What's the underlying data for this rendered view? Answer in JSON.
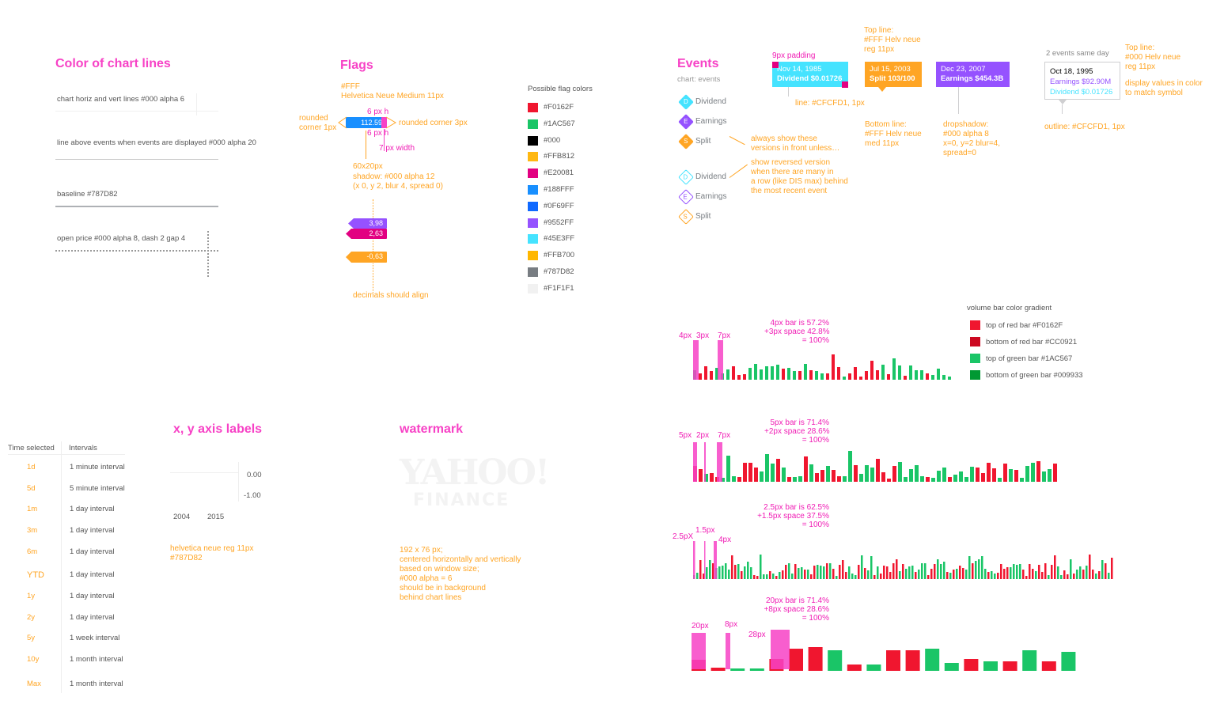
{
  "chart_lines": {
    "title": "Color of chart lines",
    "items": [
      "chart horiz and vert lines #000 alpha 6",
      "line above events when events are displayed #000 alpha 20",
      "baseline #787D82",
      "open price #000 alpha 8, dash 2 gap 4"
    ]
  },
  "flags": {
    "title": "Flags",
    "spec_1": "#FFF",
    "spec_2": "Helvetica Neue Medium 11px",
    "h_top": "6 px h",
    "h_bottom": "6 px h",
    "rounded_1px": "rounded\ncorner 1px",
    "rounded_3px": "rounded corner 3px",
    "width_note": "7 px width",
    "size_1": "60x20px",
    "size_2": "shadow: #000 alpha 12",
    "size_3": "(x 0, y 2, blur 4, spread 0)",
    "flag_main": "112.59",
    "flag_a": "3,98",
    "flag_b": "2,63",
    "flag_c": "-0,63",
    "decimals": "decimals should align",
    "palette_title": "Possible flag colors",
    "palette": [
      {
        "hex": "#F0162F",
        "label": "#F0162F"
      },
      {
        "hex": "#1AC567",
        "label": "#1AC567"
      },
      {
        "hex": "#000000",
        "label": "#000"
      },
      {
        "hex": "#FFB812",
        "label": "#FFB812"
      },
      {
        "hex": "#E20081",
        "label": "#E20081"
      },
      {
        "hex": "#188FFF",
        "label": "#188FFF"
      },
      {
        "hex": "#0F69FF",
        "label": "#0F69FF"
      },
      {
        "hex": "#9552FF",
        "label": "#9552FF"
      },
      {
        "hex": "#45E3FF",
        "label": "#45E3FF"
      },
      {
        "hex": "#FFB700",
        "label": "#FFB700"
      },
      {
        "hex": "#787D82",
        "label": "#787D82"
      },
      {
        "hex": "#F1F1F1",
        "label": "#F1F1F1"
      }
    ]
  },
  "events": {
    "title": "Events",
    "subtitle": "chart: events",
    "icons": [
      {
        "letter": "D",
        "label": "Dividend",
        "color": "#45E3FF"
      },
      {
        "letter": "E",
        "label": "Earnings",
        "color": "#9552FF"
      },
      {
        "letter": "S",
        "label": "Split",
        "color": "#FFA524"
      }
    ],
    "note_front": "always show these\nversions in front unless…",
    "note_reversed": "show reversed version\nwhen there are many in\na row (like DIS max) behind\nthe most recent event",
    "padding_note": "9px padding",
    "box_div_1": "Nov 14, 1985",
    "box_div_2": "Dividend $0.01726",
    "line_note": "line: #CFCFD1, 1px",
    "top_line_note": "Top line:\n#FFF Helv neue\nreg 11px",
    "box_split_1": "Jul 15, 2003",
    "box_split_2": "Split 103/100",
    "bottom_line_note": "Bottom line:\n#FFF Helv neue\nmed 11px",
    "box_earn_1": "Dec 23, 2007",
    "box_earn_2": "Earnings $454.3B",
    "dropshadow_note": "dropshadow:\n#000 alpha 8\nx=0, y=2 blur=4,\nspread=0",
    "same_day_title": "2 events same day",
    "same_day_date": "Oct 18, 1995",
    "same_day_earn": "Earnings $92.90M",
    "same_day_div": "Dividend $0.01726",
    "same_day_top": "Top line:\n#000 Helv neue\nreg 11px",
    "same_day_display": "display values in color\nto match symbol",
    "outline_note": "outline: #CFCFD1, 1px"
  },
  "volume": {
    "gradient_title": "volume bar color gradient",
    "gradient": [
      {
        "hex": "#F0162F",
        "label": "top of red bar #F0162F"
      },
      {
        "hex": "#CC0921",
        "label": "bottom of red bar #CC0921"
      },
      {
        "hex": "#1AC567",
        "label": "top of green bar #1AC567"
      },
      {
        "hex": "#009933",
        "label": "bottom of green bar #009933"
      }
    ],
    "groups": [
      {
        "note": "4px bar is 57.2%\n+3px space 42.8%\n= 100%",
        "labels": [
          "4px",
          "3px",
          "7px"
        ]
      },
      {
        "note": "5px bar is 71.4%\n+2px space 28.6%\n= 100%",
        "labels": [
          "5px",
          "2px",
          "7px"
        ]
      },
      {
        "note": "2.5px bar is 62.5%\n+1.5px space 37.5%\n= 100%",
        "labels": [
          "2.5pX",
          "1.5px",
          "4px"
        ]
      },
      {
        "note": "20px bar is 71.4%\n+8px space 28.6%\n= 100%",
        "labels": [
          "20px",
          "8px",
          "28px"
        ]
      }
    ]
  },
  "intervals": {
    "col_time": "Time selected",
    "col_interval": "Intervals",
    "rows": [
      {
        "time": "1d",
        "interval": "1 minute interval"
      },
      {
        "time": "5d",
        "interval": "5 minute interval"
      },
      {
        "time": "1m",
        "interval": "1 day interval"
      },
      {
        "time": "3m",
        "interval": "1 day interval"
      },
      {
        "time": "6m",
        "interval": "1 day interval"
      },
      {
        "time": "YTD",
        "interval": "1 day interval"
      },
      {
        "time": "1y",
        "interval": "1 day interval"
      },
      {
        "time": "2y",
        "interval": "1 day interval"
      },
      {
        "time": "5y",
        "interval": "1 week interval"
      },
      {
        "time": "10y",
        "interval": "1 month interval"
      },
      {
        "time": "Max",
        "interval": "1 month interval"
      }
    ]
  },
  "axis": {
    "title": "x, y axis labels",
    "y_top": "0.00",
    "y_bottom": "-1.00",
    "x_left": "2004",
    "x_right": "2015",
    "note": "helvetica neue reg 11px\n#787D82"
  },
  "watermark": {
    "title": "watermark",
    "logo_1": "YAHOO!",
    "logo_2": "FINANCE",
    "note": "192 x 76 px;\ncentered horizontally and vertically\nbased on window size;\n#000 alpha = 6\nshould be in background\nbehind chart lines"
  }
}
